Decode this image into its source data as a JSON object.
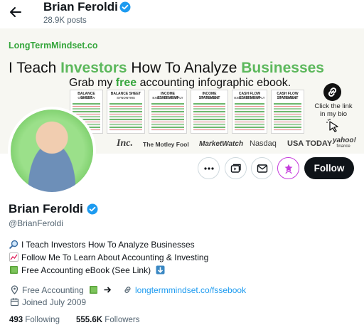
{
  "header": {
    "name": "Brian Feroldi",
    "posts": "28.9K posts"
  },
  "banner": {
    "site": "LongTermMindset.co",
    "headline_1": "I Teach ",
    "headline_2": "Investors",
    "headline_3": " How To Analyze ",
    "headline_4": "Businesses",
    "sub_1": "Grab my ",
    "sub_2": "free",
    "sub_3": " accounting infographic ebook.",
    "sheets": [
      {
        "title": "BALANCE SHEET",
        "subtitle": "OVERVIEW"
      },
      {
        "title": "BALANCE SHEET",
        "subtitle": "SYNONYMS"
      },
      {
        "title": "INCOME STATEMENT",
        "subtitle": "EXPLAINED SIMPLY"
      },
      {
        "title": "INCOME STATEMENT",
        "subtitle": "SYNONYMS"
      },
      {
        "title": "CASH FLOW STATEMENT",
        "subtitle": "EXPLAINED SIMPLY"
      },
      {
        "title": "CASH FLOW STATEMENT",
        "subtitle": "SYNONYMS"
      }
    ],
    "click_line_1": "Click the link",
    "click_line_2": "in my bio",
    "logos": {
      "inc": "Inc.",
      "motley": "The Motley Fool",
      "marketwatch": "MarketWatch",
      "nasdaq": "Nasdaq",
      "usatoday": "USA TODAY",
      "yahoo": "yahoo!",
      "yahoo_sub": "finance"
    }
  },
  "actions": {
    "more_icon": "more-icon",
    "subscriptions_icon": "subscriptions-icon",
    "message_icon": "message-icon",
    "notify_icon": "notify-icon",
    "follow_label": "Follow"
  },
  "profile": {
    "name": "Brian Feroldi",
    "handle": "@BrianFeroldi",
    "bio": [
      "I Teach Investors How To Analyze Businesses",
      "Follow Me To Learn About Accounting & Investing",
      "Free Accounting eBook (See Link)"
    ],
    "location": "Free Accounting",
    "link": "longtermmindset.co/fssebook",
    "joined": "Joined July 2009",
    "following_count": "493",
    "following_label": "Following",
    "followers_count": "555.6K",
    "followers_label": "Followers"
  },
  "colors": {
    "accent_green": "#5cb85c",
    "link_blue": "#1d9bf0",
    "verified_blue": "#1d9bf0",
    "notify_purple": "#c53cdc"
  }
}
